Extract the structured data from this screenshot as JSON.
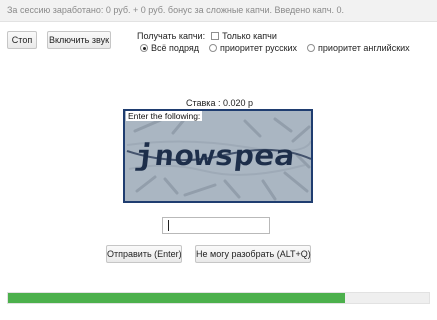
{
  "status_bar": {
    "text": "За сессию заработано: 0 руб. + 0 руб. бонус за сложные капчи. Введено капч. 0."
  },
  "buttons": {
    "stop": "Стоп",
    "sound": "Включить звук",
    "submit": "Отправить (Enter)",
    "cant_read": "Не могу разобрать  (ALT+Q)"
  },
  "options": {
    "receive_label": "Получать капчи:",
    "only_label": "Только капчи",
    "only_checked": false,
    "radios": [
      {
        "label": "Всё подряд",
        "checked": true
      },
      {
        "label": "приоритет русских",
        "checked": false
      },
      {
        "label": "приоритет английских",
        "checked": false
      }
    ]
  },
  "rate": {
    "text": "Ставка : 0.020 р"
  },
  "captcha": {
    "caption": "Enter the following:",
    "word": "jnowspea"
  },
  "answer": {
    "value": "",
    "placeholder": ""
  },
  "progress": {
    "fraction": 0.8,
    "color": "#4cb04c"
  },
  "colors": {
    "captcha_border": "#1f3d70",
    "captcha_bg": "#aab6c2",
    "captcha_text": "#1d2e4a"
  }
}
